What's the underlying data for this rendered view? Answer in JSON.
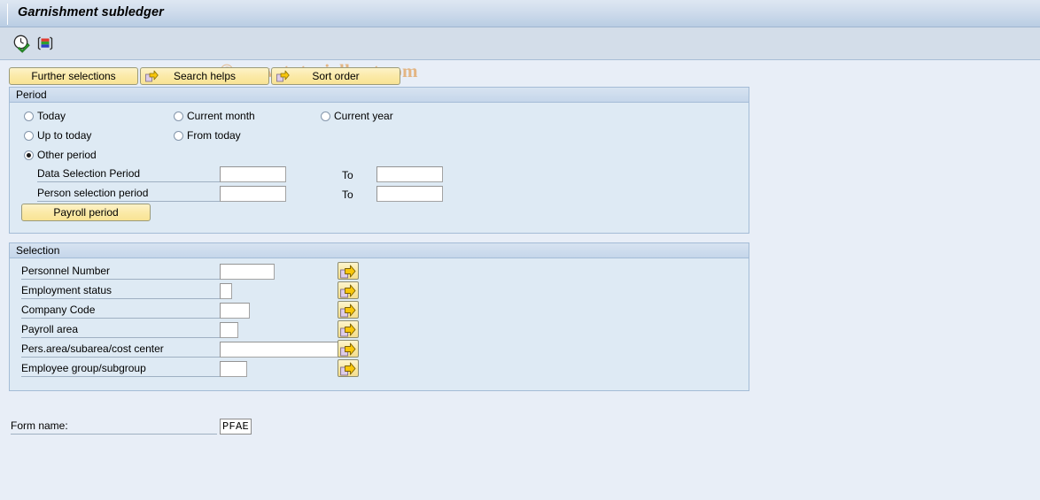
{
  "window": {
    "title": "Garnishment subledger"
  },
  "toolbar": {
    "execute_icon": "execute-clock-check-icon",
    "variant_icon": "get-variant-icon",
    "watermark": "© www.tutorialkart.com"
  },
  "action_buttons": [
    {
      "label": "Further selections",
      "icon": null
    },
    {
      "label": "Search helps",
      "icon": "arrow-right-icon"
    },
    {
      "label": "Sort order",
      "icon": "arrow-right-icon"
    }
  ],
  "period": {
    "group_title": "Period",
    "radios": [
      {
        "label": "Today",
        "checked": false
      },
      {
        "label": "Current month",
        "checked": false
      },
      {
        "label": "Current year",
        "checked": false
      },
      {
        "label": "Up to today",
        "checked": false
      },
      {
        "label": "From today",
        "checked": false
      },
      {
        "label": "Other period",
        "checked": true
      }
    ],
    "rows": [
      {
        "label": "Data Selection Period",
        "from_value": "",
        "to_label": "To",
        "to_value": ""
      },
      {
        "label": "Person selection period",
        "from_value": "",
        "to_label": "To",
        "to_value": ""
      }
    ],
    "payroll_button": "Payroll period"
  },
  "selection": {
    "group_title": "Selection",
    "rows": [
      {
        "label": "Personnel Number",
        "value": "",
        "input_width": 62,
        "multi_icon": "multiple-selection-icon"
      },
      {
        "label": "Employment status",
        "value": "",
        "input_width": 14,
        "multi_icon": "multiple-selection-icon"
      },
      {
        "label": "Company Code",
        "value": "",
        "input_width": 34,
        "multi_icon": "multiple-selection-icon"
      },
      {
        "label": "Payroll area",
        "value": "",
        "input_width": 21,
        "multi_icon": "multiple-selection-icon"
      },
      {
        "label": "Pers.area/subarea/cost center",
        "value": "",
        "input_width": 147,
        "multi_icon": "multiple-selection-icon"
      },
      {
        "label": "Employee group/subgroup",
        "value": "",
        "input_width": 31,
        "multi_icon": "multiple-selection-icon"
      }
    ]
  },
  "form": {
    "label": "Form name:",
    "value": "PFAE"
  },
  "colors": {
    "title_bar": "#cfdcec",
    "toolbar": "#d3dde9",
    "page_background": "#e8eef7",
    "group_background": "#deeaf4",
    "group_border": "#a4bcd6",
    "button_yellow": "#fbeaa8",
    "watermark": "#e3b583"
  }
}
